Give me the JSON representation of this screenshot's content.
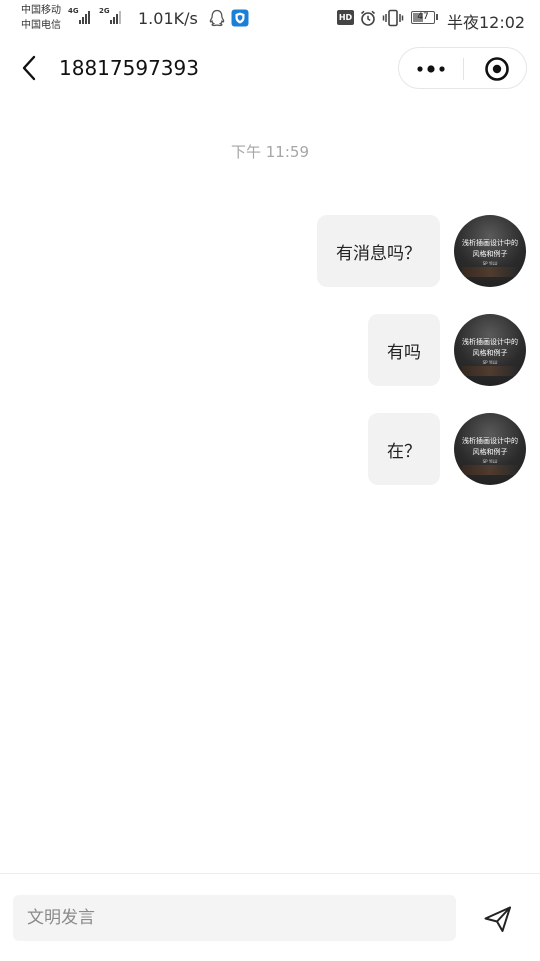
{
  "status_bar": {
    "carrier_1": "中国移动",
    "carrier_2": "中国电信",
    "net_1": "4G",
    "net_2": "2G",
    "speed": "1.01K/s",
    "hd": "HD",
    "battery_level": "47",
    "time": "半夜12:02",
    "icons": [
      "qq-icon",
      "shield-app-icon",
      "alarm-icon",
      "vibrate-icon"
    ]
  },
  "header": {
    "title": "18817597393",
    "icons": [
      "back-icon",
      "more-icon",
      "target-icon"
    ]
  },
  "chat": {
    "timestamp": "下午 11:59",
    "messages": [
      {
        "text": "有消息吗？"
      },
      {
        "text": "有吗"
      },
      {
        "text": "在？"
      }
    ],
    "avatar": {
      "line_1": "浅析插画设计中的",
      "line_2": "风格和例子",
      "tag": "SP YILU"
    }
  },
  "input_bar": {
    "placeholder": "文明发言",
    "send_icon": "send-icon"
  },
  "colors": {
    "bubble": "#f2f2f2",
    "timestamp": "#a6a6a6",
    "input_bg": "#f4f4f4"
  }
}
